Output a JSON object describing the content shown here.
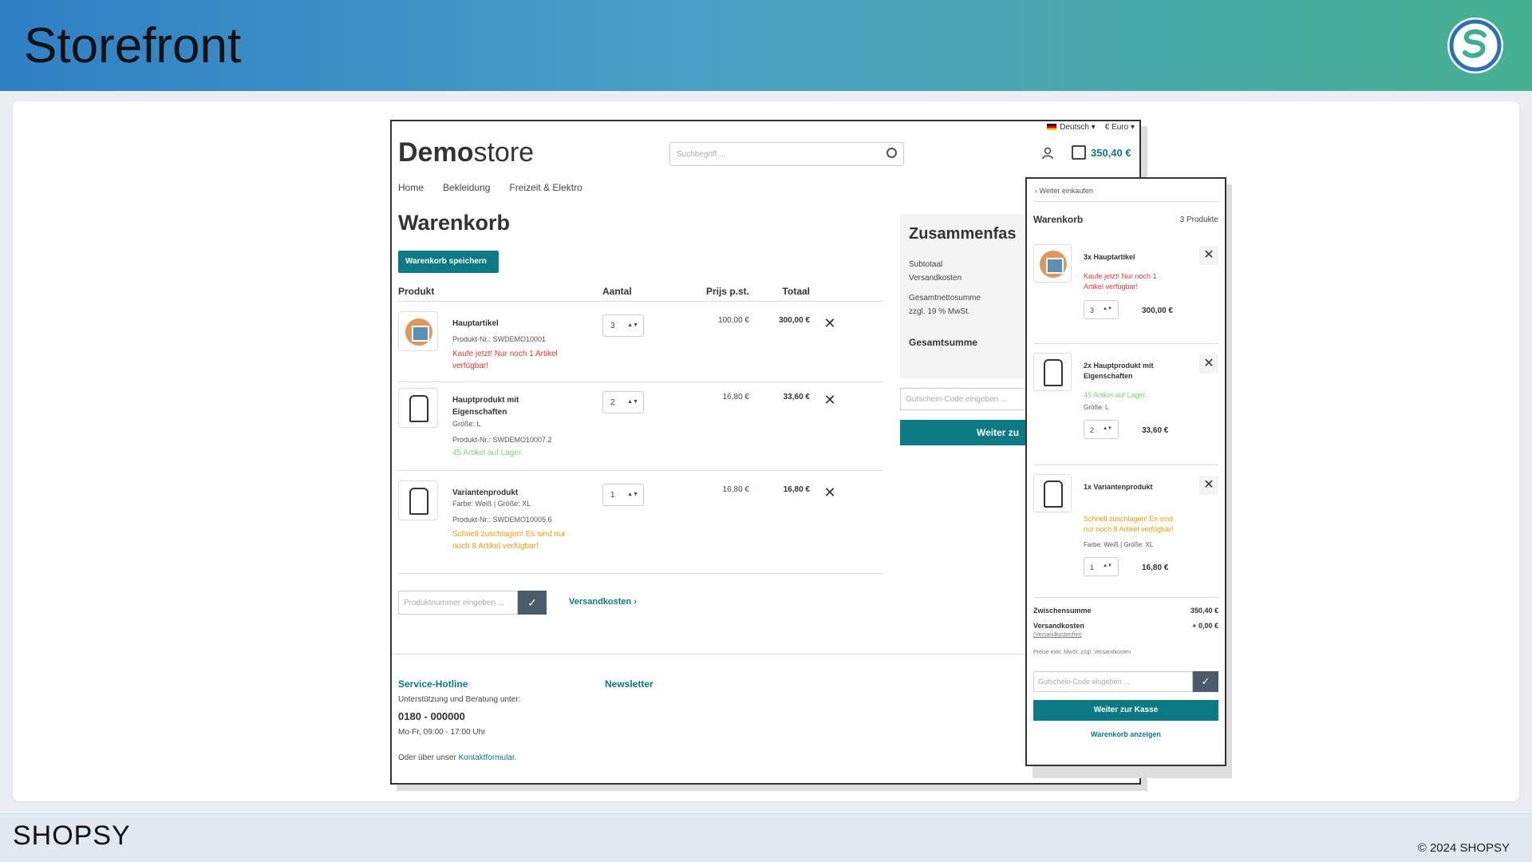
{
  "slide": {
    "title": "Storefront",
    "footer_logo": "SHOPSY",
    "copyright": "© 2024 SHOPSY"
  },
  "store": {
    "language": "Deutsch",
    "currency": "€ Euro",
    "logo_bold": "Demo",
    "logo_rest": "store",
    "search_placeholder": "Suchbegriff ...",
    "cart_total": "350,40 €",
    "nav": [
      "Home",
      "Bekleidung",
      "Freizeit & Elektro"
    ],
    "page_title": "Warenkorb",
    "save_button": "Warenkorb speichern",
    "columns": {
      "product": "Produkt",
      "qty": "Aantal",
      "unit": "Prijs p.st.",
      "total": "Totaal"
    },
    "items": [
      {
        "name": "Hauptartikel",
        "number": "Produkt-Nr.: SWDEMO10001",
        "notice": "Kaufe jetzt! Nur noch 1 Artikel verfügbar!",
        "qty": "3",
        "unit": "100,00 €",
        "total": "300,00 €"
      },
      {
        "name": "Hauptprodukt mit Eigenschaften",
        "size": "Größe: L",
        "number": "Produkt-Nr.: SWDEMO10007.2",
        "stock": "45 Artikel auf Lager.",
        "qty": "2",
        "unit": "16,80 €",
        "total": "33,60 €"
      },
      {
        "name": "Variantenprodukt",
        "variant": "Farbe: Weiß | Größe: XL",
        "number": "Produkt-Nr.: SWDEMO10005.6",
        "notice": "Schnell zuschlagen! Es sind nur noch 8 Artikel verfügbar!",
        "qty": "1",
        "unit": "16,80 €",
        "total": "16,80 €"
      }
    ],
    "product_number_placeholder": "Produktnummer eingeben ...",
    "shipping_link": "Versandkosten",
    "summary": {
      "title": "Zusammenfas",
      "subtotal": "Subtotaal",
      "shipping": "Versandkosten",
      "net": "Gesamtnettosumme",
      "tax": "zzgl. 19 % MwSt.",
      "grand": "Gesamtsumme"
    },
    "coupon_placeholder": "Gutschein-Code eingeben ...",
    "checkout_button": "Weiter zu",
    "footer": {
      "hotline_title": "Service-Hotline",
      "hotline_text": "Unterstützung und Beratung unter:",
      "phone": "0180 - 000000",
      "hours": "Mo-Fr, 09:00 - 17:00 Uhr",
      "contact_prefix": "Oder über unser ",
      "contact_link": "Kontaktformular.",
      "newsletter": "Newsletter"
    }
  },
  "offcanvas": {
    "back": "Weiter einkaufen",
    "title": "Warenkorb",
    "count": "3 Produkte",
    "items": [
      {
        "name": "3x Hauptartikel",
        "notice": "Kaufe jetzt! Nur noch 1 Artikel verfügbar!",
        "qty": "3",
        "price": "300,00 €"
      },
      {
        "name": "2x Hauptprodukt mit Eigenschaften",
        "stock": "45 Artikel auf Lager.",
        "size": "Größe: L",
        "qty": "2",
        "price": "33,60 €"
      },
      {
        "name": "1x Variantenprodukt",
        "notice": "Schnell zuschlagen! Es sind nur noch 8 Artikel verfügbar!",
        "variant": "Farbe: Weiß | Größe: XL",
        "qty": "1",
        "price": "16,80 €"
      }
    ],
    "subtotal_label": "Zwischensumme",
    "subtotal": "350,40 €",
    "shipping_label": "Versandkosten",
    "shipping": "+ 0,00 €",
    "shipping_free": "(Versandkostenfrei)",
    "tax_note": "Preise exkl. MwSt. zzgl. Versandkosten",
    "coupon_placeholder": "Gutschein-Code eingeben ...",
    "checkout": "Weiter zur Kasse",
    "view_cart": "Warenkorb anzeigen"
  }
}
